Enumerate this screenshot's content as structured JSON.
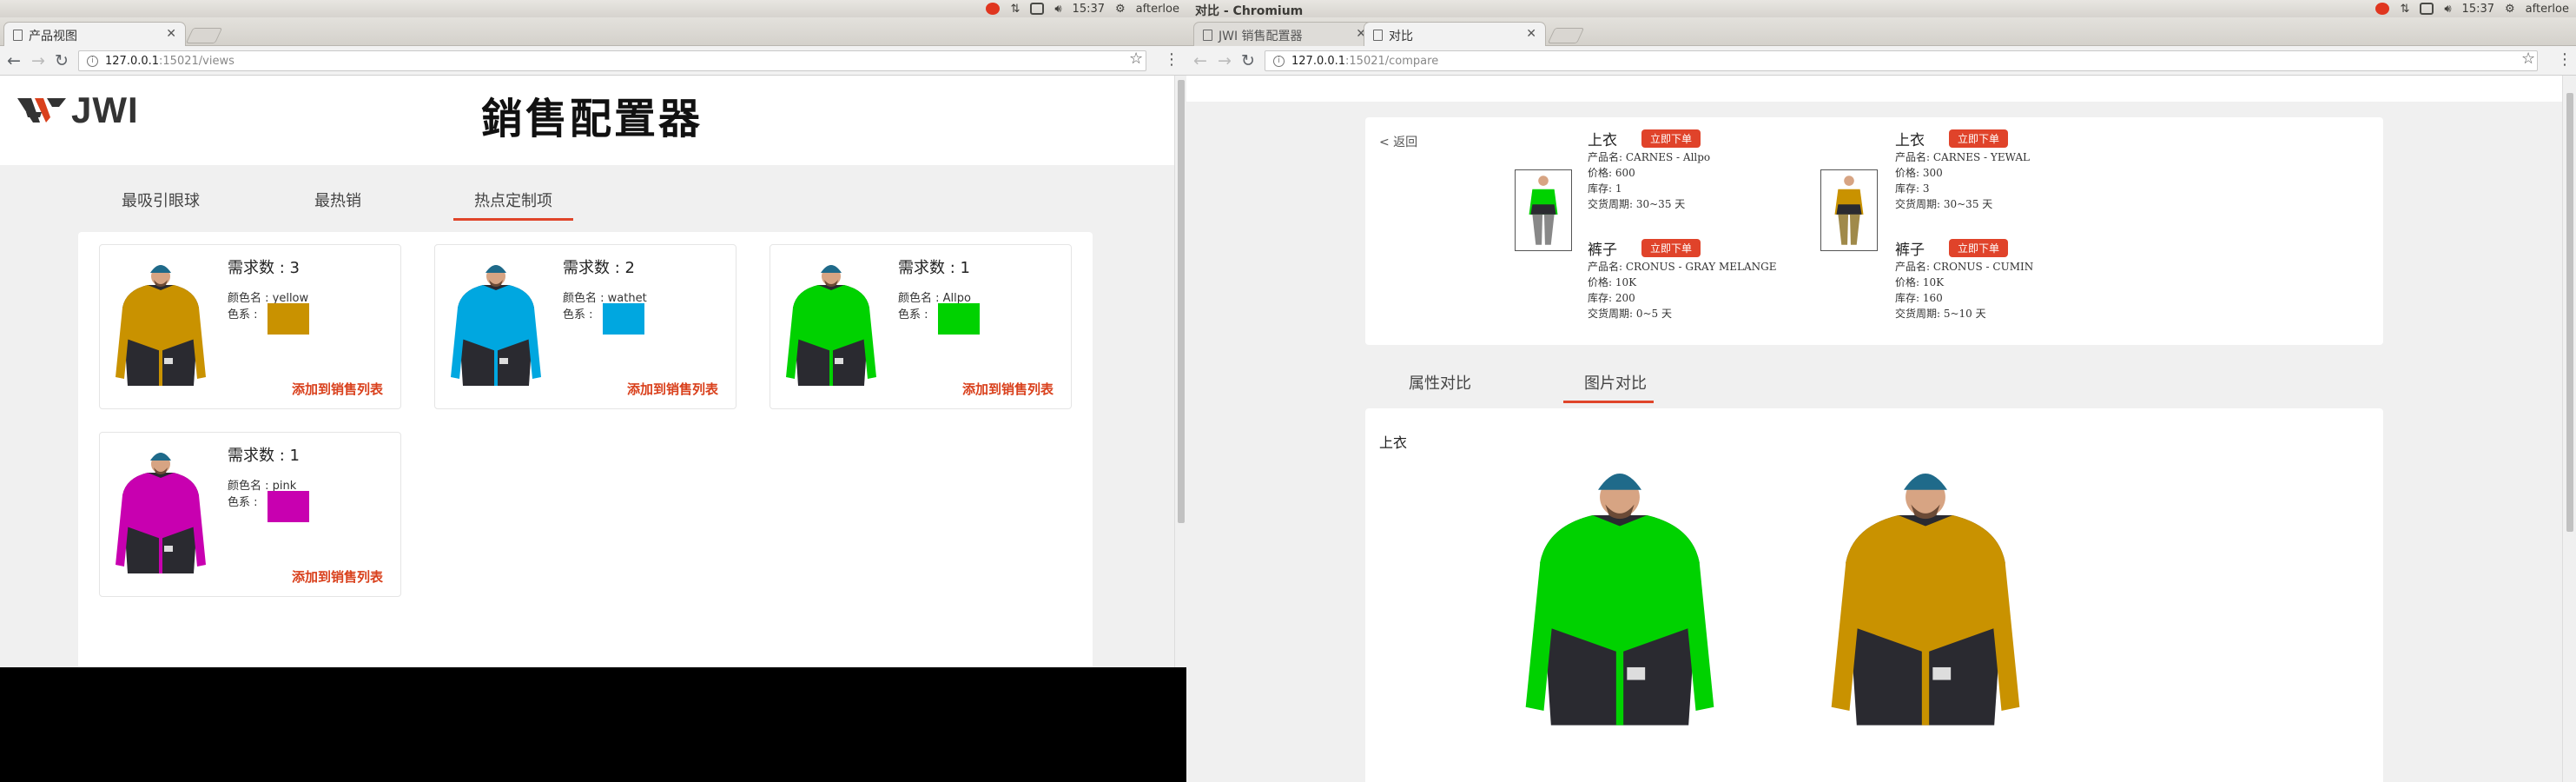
{
  "left": {
    "sysbar": {
      "time": "15:37",
      "user": "afterloe"
    },
    "tabs": [
      {
        "label": "产品视图"
      }
    ],
    "url": {
      "host": "127.0.0.1",
      "rest": ":15021/views"
    },
    "header": {
      "logo_text": "JWI",
      "title": "銷售配置器"
    },
    "nav_tabs": [
      "最吸引眼球",
      "最热销",
      "热点定制项"
    ],
    "cards": [
      {
        "need": "需求数 : 3",
        "color_name": "颜色名 : yellow",
        "color_label": "色系 :",
        "swatch": "#c99200",
        "jacket": "#c99200",
        "add": "添加到销售列表"
      },
      {
        "need": "需求数 : 2",
        "color_name": "颜色名 : wathet",
        "color_label": "色系 :",
        "swatch": "#00a7e0",
        "jacket": "#00a7e0",
        "add": "添加到销售列表"
      },
      {
        "need": "需求数 : 1",
        "color_name": "颜色名 : Allpo",
        "color_label": "色系 :",
        "swatch": "#00d200",
        "jacket": "#00d200",
        "add": "添加到销售列表"
      },
      {
        "need": "需求数 : 1",
        "color_name": "颜色名 : pink",
        "color_label": "色系 :",
        "swatch": "#c800b0",
        "jacket": "#c800b0",
        "add": "添加到销售列表"
      }
    ]
  },
  "right": {
    "window_title": "对比 - Chromium",
    "sysbar": {
      "time": "15:37",
      "user": "afterloe"
    },
    "tabs": [
      {
        "label": "JWI 销售配置器"
      },
      {
        "label": "对比"
      }
    ],
    "url": {
      "host": "127.0.0.1",
      "rest": ":15021/compare"
    },
    "back": "< 返回",
    "order_button": "立即下单",
    "items": [
      {
        "title": "上衣",
        "lines": [
          "产品名: CARNES - Allpo",
          "价格: 600",
          "库存: 1",
          "交货周期: 30~35 天"
        ]
      },
      {
        "title": "裤子",
        "lines": [
          "产品名: CRONUS - GRAY MELANGE",
          "价格: 10K",
          "库存: 200",
          "交货周期: 0~5 天"
        ]
      },
      {
        "title": "上衣",
        "lines": [
          "产品名: CARNES - YEWAL",
          "价格: 300",
          "库存: 3",
          "交货周期: 30~35 天"
        ]
      },
      {
        "title": "裤子",
        "lines": [
          "产品名: CRONUS - CUMIN",
          "价格: 10K",
          "库存: 160",
          "交货周期: 5~10 天"
        ]
      }
    ],
    "nav_tabs": [
      "属性对比",
      "图片对比"
    ],
    "image_section_label": "上衣",
    "compare_colors": [
      "#00d200",
      "#c99200"
    ],
    "thumb_colors": [
      {
        "top": "#00d200",
        "pants": "#888888"
      },
      {
        "top": "#c99200",
        "pants": "#a08a4a"
      }
    ]
  },
  "theme": {
    "accent": "#e0452a"
  }
}
